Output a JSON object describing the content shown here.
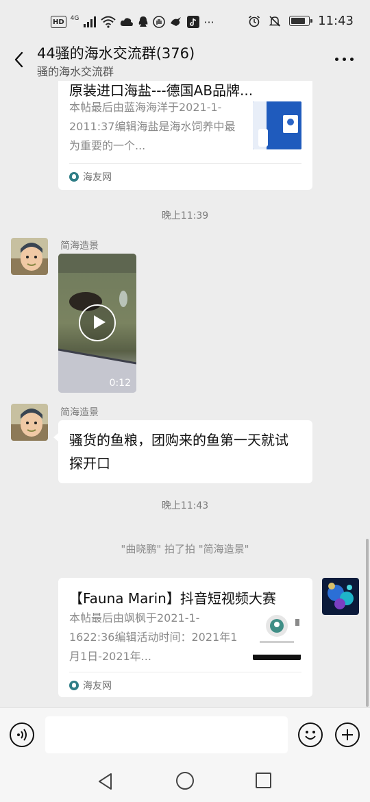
{
  "status_bar": {
    "network_badge": "HD",
    "network_type": "4G",
    "time": "11:43"
  },
  "header": {
    "title": "44骚的海水交流群(376)",
    "subtitle": "骚的海水交流群"
  },
  "messages": {
    "card1": {
      "title": "原装进口海盐---德国AB品牌...",
      "desc": "本帖最后由蓝海海洋于2021-1-2011:37编辑海盐是海水饲养中最为重要的一个...",
      "source": "海友网"
    },
    "time1": "晚上11:39",
    "video_msg": {
      "sender": "简海造景",
      "duration": "0:12"
    },
    "text_msg": {
      "sender": "简海造景",
      "text": "骚货的鱼粮，团购来的鱼第一天就试探开口"
    },
    "time2": "晚上11:43",
    "system": "\"曲晓鹏\" 拍了拍 \"简海造景\"",
    "card2": {
      "title": "【Fauna Marin】抖音短视频大赛",
      "desc": "本帖最后由飒枫于2021-1-1622:36编辑活动时间：2021年1月1日-2021年...",
      "source": "海友网"
    }
  },
  "input": {
    "placeholder": ""
  },
  "icons": {
    "back": "back-arrow-icon",
    "more": "more-icon",
    "voice": "voice-icon",
    "emoji": "emoji-icon",
    "plus": "plus-icon"
  },
  "colors": {
    "background": "#ededed",
    "bubble": "#ffffff",
    "source_logo": "#2f7d86"
  }
}
